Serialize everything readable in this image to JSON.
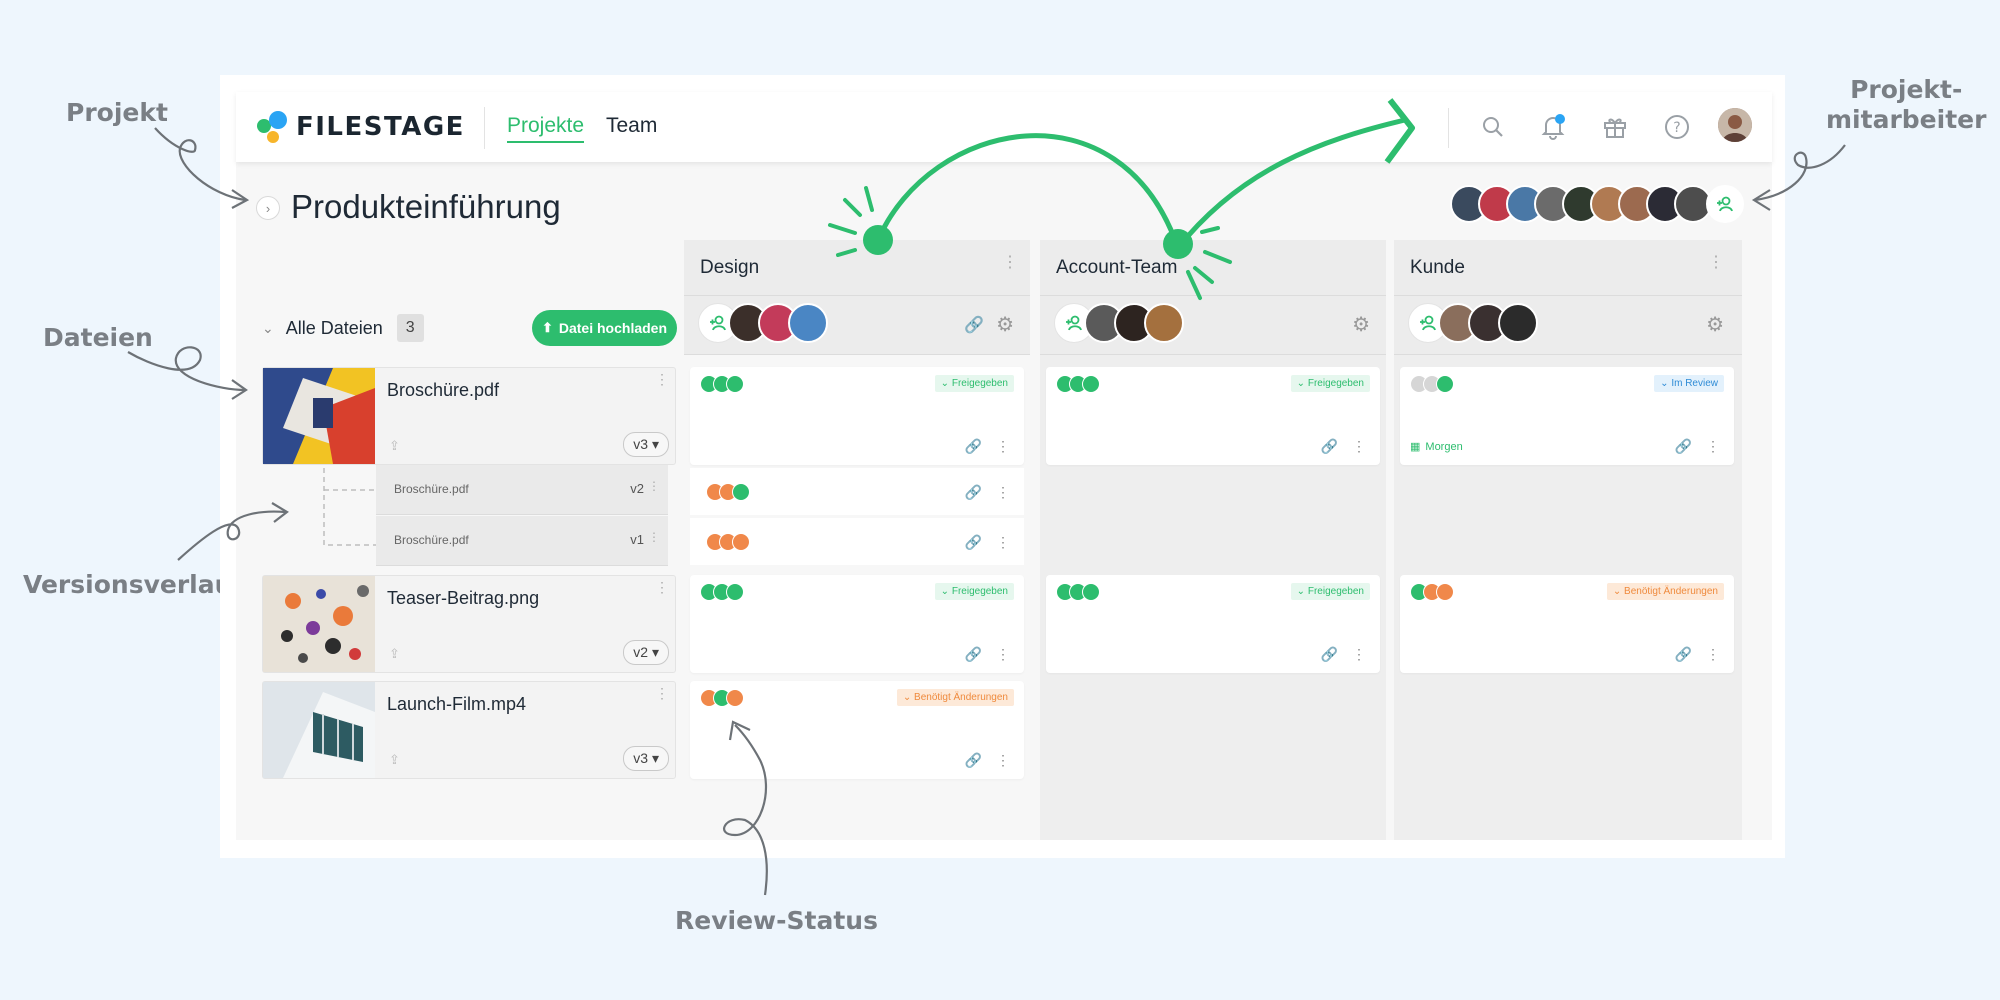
{
  "annotations": {
    "project": "Projekt",
    "files": "Dateien",
    "version_history": "Versionsverlauf",
    "review_status": "Review-Status",
    "collaborators_line1": "Projekt-",
    "collaborators_line2": "mitarbeiter"
  },
  "brand": {
    "name": "FILESTAGE",
    "accent": "#2dbd6e"
  },
  "nav": {
    "projects": "Projekte",
    "team": "Team"
  },
  "icons": [
    "search-icon",
    "bell-icon",
    "gift-icon",
    "help-icon"
  ],
  "project": {
    "title": "Produkteinführung"
  },
  "files_header": {
    "label": "Alle Dateien",
    "count": "3",
    "upload": "Datei hochladen"
  },
  "columns": [
    {
      "title": "Design"
    },
    {
      "title": "Account-Team"
    },
    {
      "title": "Kunde"
    }
  ],
  "files": [
    {
      "name": "Broschüre.pdf",
      "version": "v3"
    },
    {
      "name": "Teaser-Beitrag.png",
      "version": "v2"
    },
    {
      "name": "Launch-Film.mp4",
      "version": "v3"
    }
  ],
  "versions": [
    {
      "name": "Broschüre.pdf",
      "version": "v2"
    },
    {
      "name": "Broschüre.pdf",
      "version": "v1"
    }
  ],
  "statuses": {
    "approved": "Freigegeben",
    "in_review": "Im Review",
    "needs_changes": "Benötigt Änderungen",
    "due": "Morgen"
  },
  "colors": {
    "green": "#2dbd6e",
    "orange": "#f0884a",
    "grey": "#d6d6d6",
    "blue": "#2e8bd6"
  }
}
